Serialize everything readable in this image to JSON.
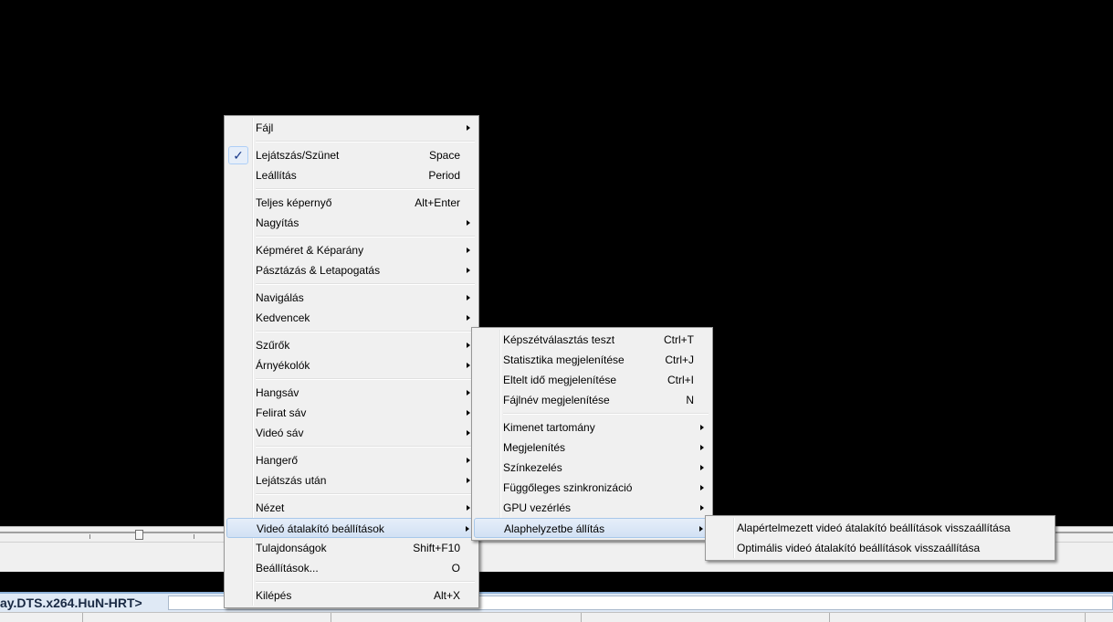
{
  "info_bar": {
    "title": "ay.DTS.x264.HuN-HRT>"
  },
  "main_menu": {
    "file": "Fájl",
    "play_pause": "Lejátszás/Szünet",
    "play_pause_sc": "Space",
    "stop": "Leállítás",
    "stop_sc": "Period",
    "fullscreen": "Teljes képernyő",
    "fullscreen_sc": "Alt+Enter",
    "zoom": "Nagyítás",
    "video_frame": "Képméret & Képarány",
    "pan_scan": "Pásztázás & Letapogatás",
    "navigate": "Navigálás",
    "favorites": "Kedvencek",
    "filters": "Szűrők",
    "shaders": "Árnyékolók",
    "audio": "Hangsáv",
    "subtitles": "Felirat sáv",
    "video_track": "Videó sáv",
    "volume": "Hangerő",
    "after_playback": "Lejátszás után",
    "view": "Nézet",
    "renderer_settings": "Videó átalakító beállítások",
    "properties": "Tulajdonságok",
    "properties_sc": "Shift+F10",
    "options": "Beállítások...",
    "options_sc": "O",
    "exit": "Kilépés",
    "exit_sc": "Alt+X",
    "check_mark": "✓"
  },
  "video_menu": {
    "tearing_test": "Képszétválasztás teszt",
    "tearing_test_sc": "Ctrl+T",
    "show_stats": "Statisztika megjelenítése",
    "show_stats_sc": "Ctrl+J",
    "show_elapsed": "Eltelt idő megjelenítése",
    "show_elapsed_sc": "Ctrl+I",
    "show_filename": "Fájlnév megjelenítése",
    "show_filename_sc": "N",
    "output_range": "Kimenet tartomány",
    "presentation": "Megjelenítés",
    "color_management": "Színkezelés",
    "vsync": "Függőleges szinkronizáció",
    "gpu_control": "GPU vezérlés",
    "reset": "Alaphelyzetbe állítás"
  },
  "reset_menu": {
    "reset_default": "Alapértelmezett videó átalakító beállítások visszaállítása",
    "reset_optimal": "Optimális videó átalakító beállítások visszaállítása"
  }
}
